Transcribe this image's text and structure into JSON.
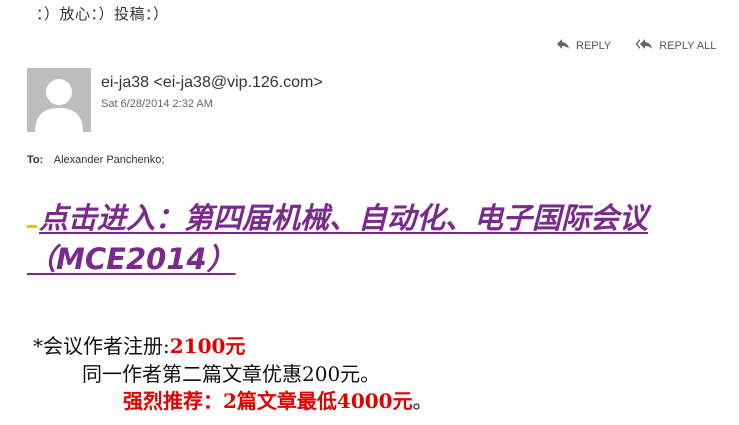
{
  "subject": "：）放心：）投稿：）",
  "actions": {
    "reply": "REPLY",
    "reply_all": "REPLY ALL"
  },
  "sender": {
    "display": "ei-ja38 <ei-ja38@vip.126.com>",
    "date": "Sat 6/28/2014 2:32 AM"
  },
  "recipients": {
    "label": "To:",
    "value": "Alexander Panchenko;"
  },
  "body": {
    "headline": "点击进入：第四届机械、自动化、电子国际会议（MCE2014）",
    "line1_text": "*会议作者注册:",
    "line1_price": "2100元",
    "line2": "同一作者第二篇文章优惠200元。",
    "line3_red": "强烈推荐：2篇文章最低4000元",
    "line3_end": "。"
  },
  "colors": {
    "link": "#7a2a8a",
    "highlight": "#e00000",
    "marker": "#e8c200"
  },
  "icons": [
    "reply-icon",
    "reply-all-icon",
    "forward-icon",
    "avatar-placeholder"
  ]
}
